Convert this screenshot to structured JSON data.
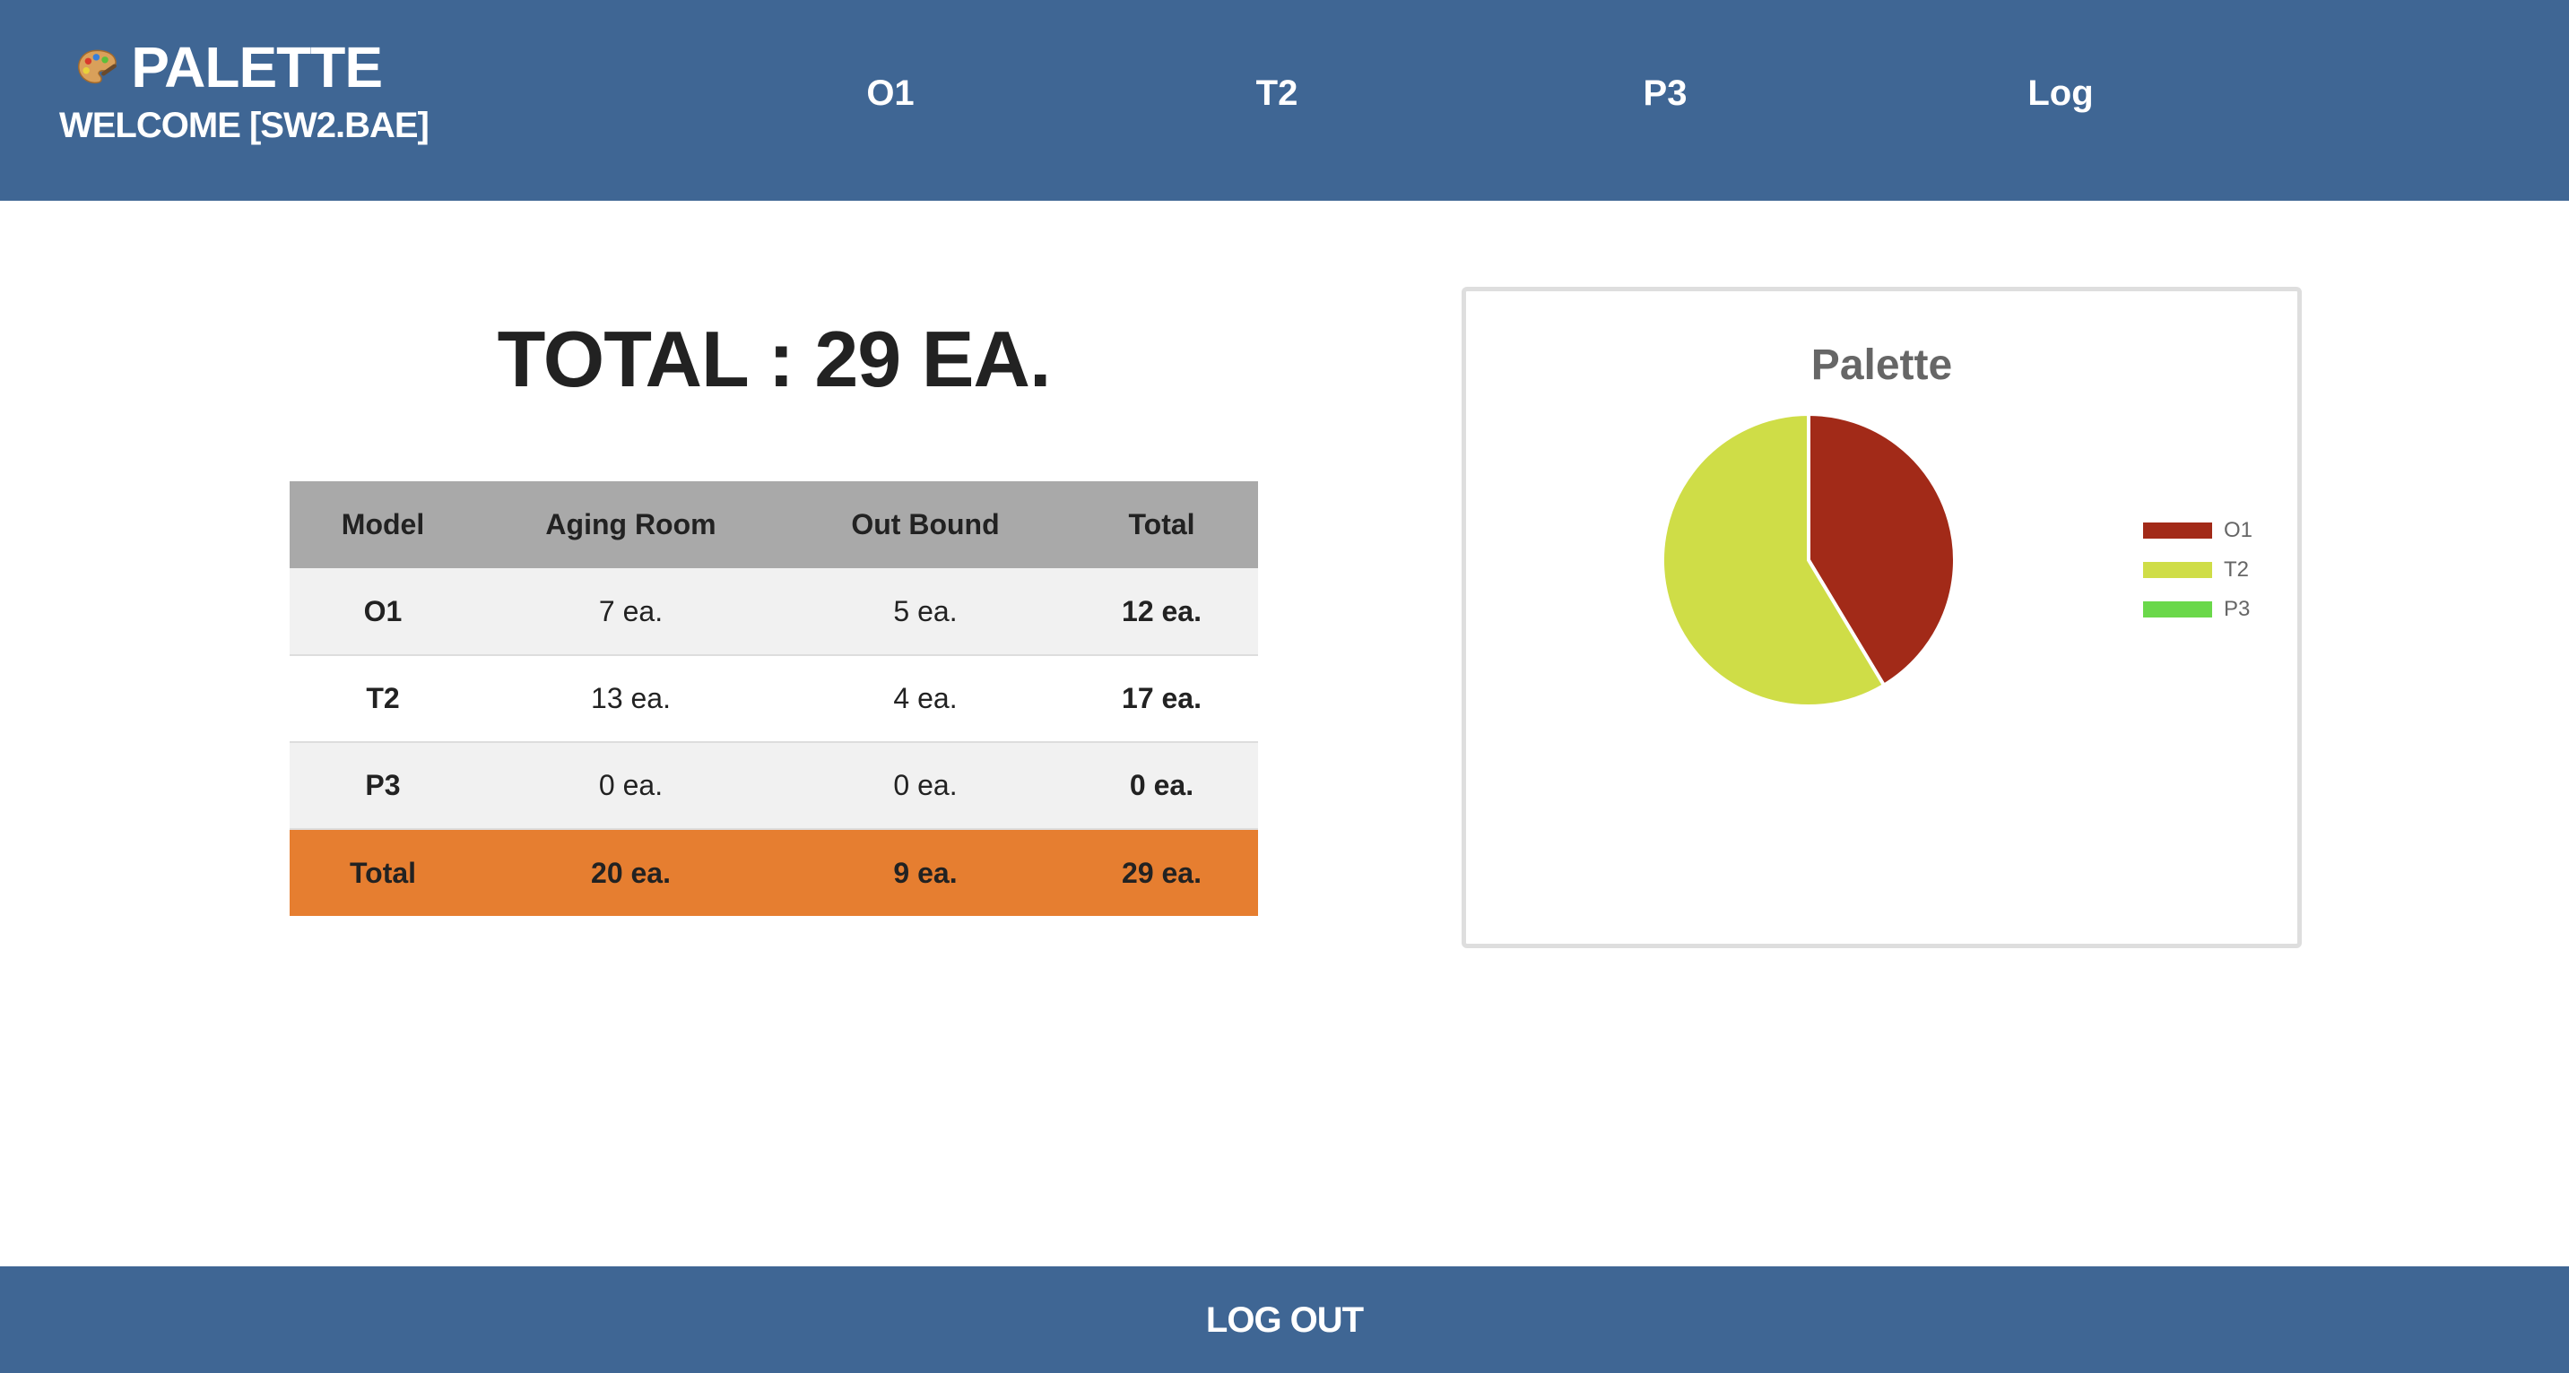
{
  "header": {
    "brand_title": "PALETTE",
    "welcome": "WELCOME [SW2.BAE]",
    "nav": [
      "O1",
      "T2",
      "P3",
      "Log"
    ]
  },
  "summary": {
    "total_heading": "TOTAL : 29 EA."
  },
  "table": {
    "headers": [
      "Model",
      "Aging Room",
      "Out Bound",
      "Total"
    ],
    "rows": [
      [
        "O1",
        "7 ea.",
        "5 ea.",
        "12 ea."
      ],
      [
        "T2",
        "13 ea.",
        "4 ea.",
        "17 ea."
      ],
      [
        "P3",
        "0 ea.",
        "0 ea.",
        "0 ea."
      ]
    ],
    "total_row": [
      "Total",
      "20 ea.",
      "9 ea.",
      "29 ea."
    ]
  },
  "chart_data": {
    "type": "pie",
    "title": "Palette",
    "categories": [
      "O1",
      "T2",
      "P3"
    ],
    "values": [
      12,
      17,
      0
    ],
    "colors": [
      "#a22a18",
      "#cfdd47",
      "#6ad84a"
    ],
    "legend_position": "right"
  },
  "footer": {
    "logout_label": "LOG OUT"
  },
  "colors": {
    "header_bg": "#3f6694",
    "table_header_bg": "#a9a9a9",
    "total_row_bg": "#e67e30"
  }
}
